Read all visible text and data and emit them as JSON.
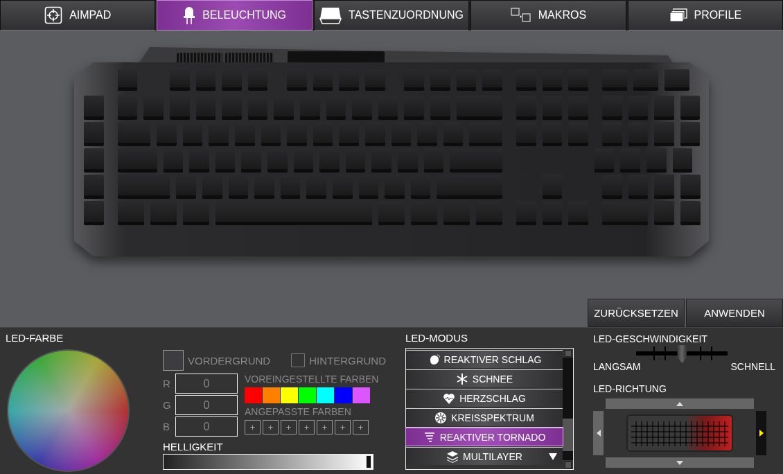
{
  "tabs": [
    {
      "label": "AIMPAD",
      "kind": "aim",
      "selected": false
    },
    {
      "label": "BELEUCHTUNG",
      "kind": "led",
      "selected": true
    },
    {
      "label": "TASTENZUORDNUNG",
      "kind": "key",
      "selected": false
    },
    {
      "label": "MAKROS",
      "kind": "macro",
      "selected": false
    },
    {
      "label": "PROFILE",
      "kind": "profile",
      "selected": false
    }
  ],
  "actions": [
    "ZURÜCKSETZEN",
    "ANWENDEN"
  ],
  "led_color": {
    "title": "LED-FARBE",
    "targets": [
      {
        "label": "VORDERGRUND",
        "selected": true
      },
      {
        "label": "HINTERGRUND",
        "selected": false
      }
    ],
    "channels": [
      {
        "label": "R",
        "value": "0"
      },
      {
        "label": "G",
        "value": "0"
      },
      {
        "label": "B",
        "value": "0"
      }
    ],
    "preset_title": "VOREINGESTELLTE FARBEN",
    "presets": [
      {
        "color": "#ff0000"
      },
      {
        "color": "#ff8000"
      },
      {
        "color": "#ffff00"
      },
      {
        "color": "#00ff00"
      },
      {
        "color": "#00ffff"
      },
      {
        "color": "#0000ff"
      },
      {
        "color": "#dd55ff"
      }
    ],
    "custom_title": "ANGEPASSTE FARBEN",
    "custom_slots": [
      "+",
      "+",
      "+",
      "+",
      "+",
      "+",
      "+"
    ],
    "brightness": {
      "label": "HELLIGKEIT",
      "level": 0.98
    }
  },
  "led_mode": {
    "title": "LED-MODUS",
    "items": [
      {
        "label": "REAKTIVER SCHLAG",
        "kind": "hand",
        "selected": false
      },
      {
        "label": "SCHNEE",
        "kind": "snow",
        "selected": false
      },
      {
        "label": "HERZSCHLAG",
        "kind": "heart",
        "selected": false
      },
      {
        "label": "KREISSPEKTRUM",
        "kind": "circle",
        "selected": false
      },
      {
        "label": "REAKTIVER TORNADO",
        "kind": "tornado",
        "selected": true
      },
      {
        "label": "MULTILAYER",
        "kind": "layers",
        "selected": false
      }
    ]
  },
  "led_speed": {
    "title": "LED-GESCHWINDIGKEIT",
    "min_label": "LANGSAM",
    "max_label": "SCHNELL",
    "level": 0.5
  },
  "led_direction": {
    "title": "LED-RICHTUNG",
    "directions": [
      {
        "kind": "up",
        "selected": false
      },
      {
        "kind": "left",
        "selected": false
      },
      {
        "kind": "right",
        "selected": true
      },
      {
        "kind": "down",
        "selected": false
      }
    ]
  }
}
